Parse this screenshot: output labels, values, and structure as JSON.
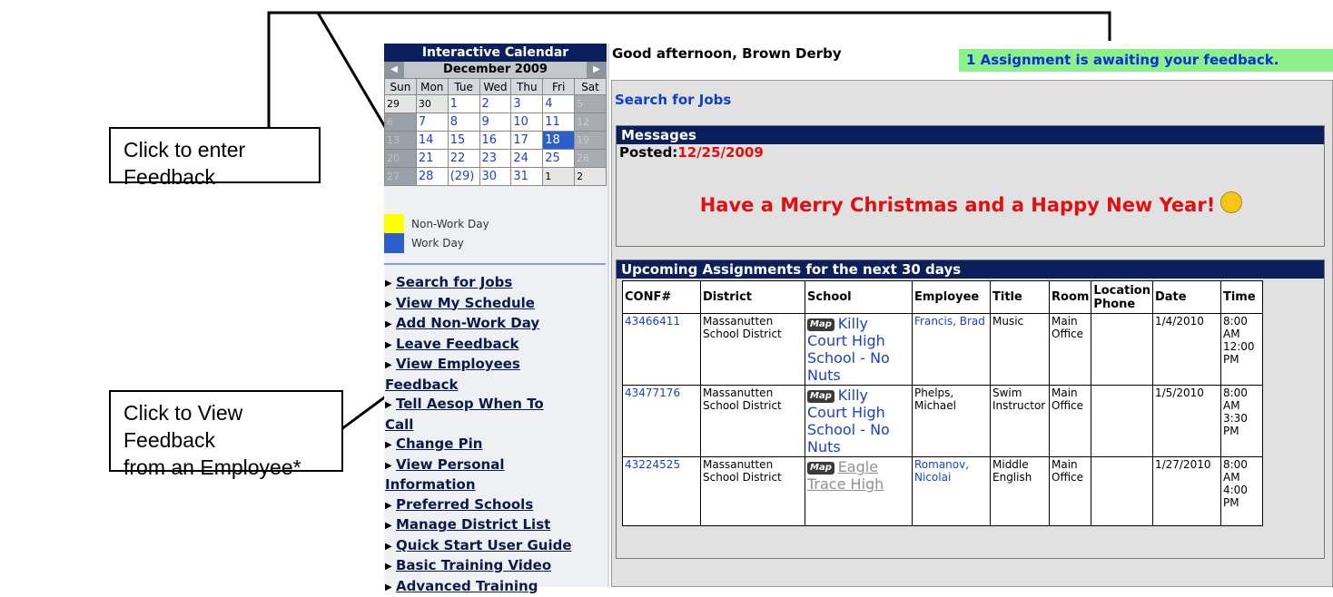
{
  "callouts": {
    "feedback_enter": "Click to enter Feedback",
    "feedback_view_line1": "Click to View Feedback",
    "feedback_view_line2": "from an Employee*"
  },
  "calendar": {
    "title": "Interactive Calendar",
    "month": "December 2009",
    "prev": "◀",
    "next": "▶",
    "days": [
      "Sun",
      "Mon",
      "Tue",
      "Wed",
      "Thu",
      "Fri",
      "Sat"
    ],
    "weeks": [
      [
        "29",
        "30",
        "1",
        "2",
        "3",
        "4",
        "5"
      ],
      [
        "6",
        "7",
        "8",
        "9",
        "10",
        "11",
        "12"
      ],
      [
        "13",
        "14",
        "15",
        "16",
        "17",
        "18",
        "19"
      ],
      [
        "20",
        "21",
        "22",
        "23",
        "24",
        "25",
        "26"
      ],
      [
        "27",
        "28",
        "(29)",
        "30",
        "31",
        "1",
        "2"
      ]
    ]
  },
  "legend": {
    "nonwork": "Non-Work Day",
    "work": "Work Day",
    "nonwork_color": "#ffff00",
    "work_color": "#2b5fcc"
  },
  "nav": {
    "items": [
      "Search for Jobs",
      "View My Schedule",
      "Add Non-Work Day",
      "Leave Feedback",
      "View Employees",
      "Feedback",
      "Tell Aesop When To",
      "Call",
      "Change Pin",
      "View Personal",
      "Information",
      "Preferred Schools",
      "Manage District List",
      "Quick Start User Guide",
      "Basic Training Video",
      "Advanced Training"
    ]
  },
  "header": {
    "greeting": "Good afternoon, Brown Derby",
    "feedback_notice": "1 Assignment is awaiting your feedback."
  },
  "main": {
    "search_link": "Search for Jobs",
    "messages": {
      "title": "Messages",
      "posted_label": "Posted:",
      "posted_date": "12/25/2009",
      "text": "Have a Merry Christmas and a Happy New Year!"
    },
    "assignments": {
      "title": "Upcoming Assignments for the next 30 days",
      "columns": [
        "CONF#",
        "District",
        "School",
        "Employee",
        "Title",
        "Room",
        "Location Phone",
        "Date",
        "Time"
      ],
      "rows": [
        {
          "conf": "43466411",
          "district": "Massanutten School District",
          "map": "Map",
          "school": "Killy Court High School - No Nuts",
          "employee": "Francis, Brad",
          "title": "Music",
          "room": "Main Office",
          "phone": "",
          "date": "1/4/2010",
          "time": "8:00 AM 12:00 PM"
        },
        {
          "conf": "43477176",
          "district": "Massanutten School District",
          "map": "Map",
          "school": "Killy Court High School - No Nuts",
          "employee": "Phelps, Michael",
          "title": "Swim Instructor",
          "room": "Main Office",
          "phone": "",
          "date": "1/5/2010",
          "time": "8:00 AM 3:30 PM"
        },
        {
          "conf": "43224525",
          "district": "Massanutten School District",
          "map": "Map",
          "school": "Eagle Trace High",
          "employee": "Romanov, Nicolai",
          "title": "Middle English",
          "room": "Main Office",
          "phone": "",
          "date": "1/27/2010",
          "time": "8:00 AM 4:00 PM"
        }
      ]
    }
  }
}
